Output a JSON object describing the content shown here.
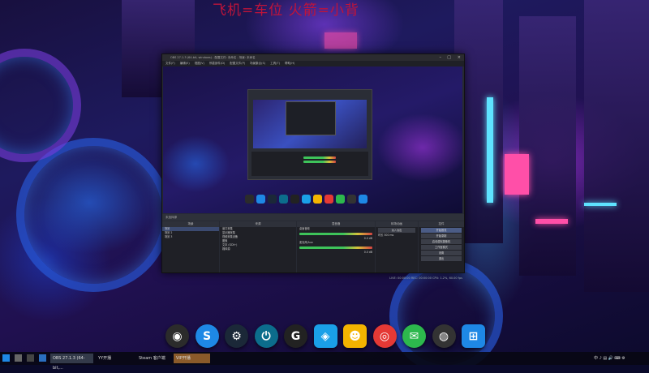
{
  "banner": {
    "text": "飞机=车位 火箭=小背"
  },
  "obs": {
    "title": "OBS 27.1.3 (64-bit, windows) - 配置文件: 未命名 - 场景: 未命名",
    "menu": [
      "文件(F)",
      "编辑(E)",
      "视图(V)",
      "停靠部件(D)",
      "配置文件(P)",
      "场景集合(S)",
      "工具(T)",
      "帮助(H)"
    ],
    "toolbar_label": "未选择源",
    "docks": {
      "scenes": {
        "title": "场景",
        "items": [
          "场景",
          "场景 2",
          "场景 3"
        ]
      },
      "sources": {
        "title": "来源",
        "items": [
          "窗口采集",
          "显示器采集",
          "视频采集设备",
          "图像",
          "文本 (GDI+)",
          "媒体源"
        ]
      },
      "mixer": {
        "title": "混音器",
        "tracks": [
          {
            "name": "桌面音频",
            "level": "0.0 dB"
          },
          {
            "name": "麦克风/Aux",
            "level": "0.0 dB"
          }
        ]
      },
      "transitions": {
        "title": "转场动画",
        "type": "淡入淡出",
        "duration_label": "时长",
        "duration": "300 ms"
      },
      "controls": {
        "title": "控件",
        "buttons": [
          "开始推流",
          "开始录制",
          "启动虚拟摄像机",
          "工作室模式",
          "设置",
          "退出"
        ]
      }
    },
    "status": "LIVE: 00:00:00   REC: 00:00:00   CPU: 1.2%, 60.00 fps"
  },
  "dock_icons": [
    {
      "name": "obs-icon",
      "glyph": "◉",
      "color": "#2b2b2b"
    },
    {
      "name": "bilibili-icon",
      "glyph": "S",
      "color": "#1e88e5"
    },
    {
      "name": "steam-icon",
      "glyph": "⚙",
      "color": "#1b2838"
    },
    {
      "name": "power-icon",
      "glyph": "⏻",
      "color": "#0c6d8c"
    },
    {
      "name": "g-app-icon",
      "glyph": "G",
      "color": "#222222"
    },
    {
      "name": "blue-cube-icon",
      "glyph": "◈",
      "color": "#1aa0e8"
    },
    {
      "name": "cat-icon",
      "glyph": "☻",
      "color": "#f4b400"
    },
    {
      "name": "netease-music-icon",
      "glyph": "◎",
      "color": "#e53935"
    },
    {
      "name": "wechat-icon",
      "glyph": "✉",
      "color": "#2db84d"
    },
    {
      "name": "camera-icon",
      "glyph": "◍",
      "color": "#333333"
    },
    {
      "name": "windows-icon",
      "glyph": "⊞",
      "color": "#1e88e5"
    }
  ],
  "taskbar": {
    "items": [
      "OBS 27.1.3 (64-bit,...",
      "YY开播",
      "Steam 客户端",
      "VIP开播"
    ],
    "tray": "中 ♪ ▤ 🔊 ⌨ ⚙"
  }
}
